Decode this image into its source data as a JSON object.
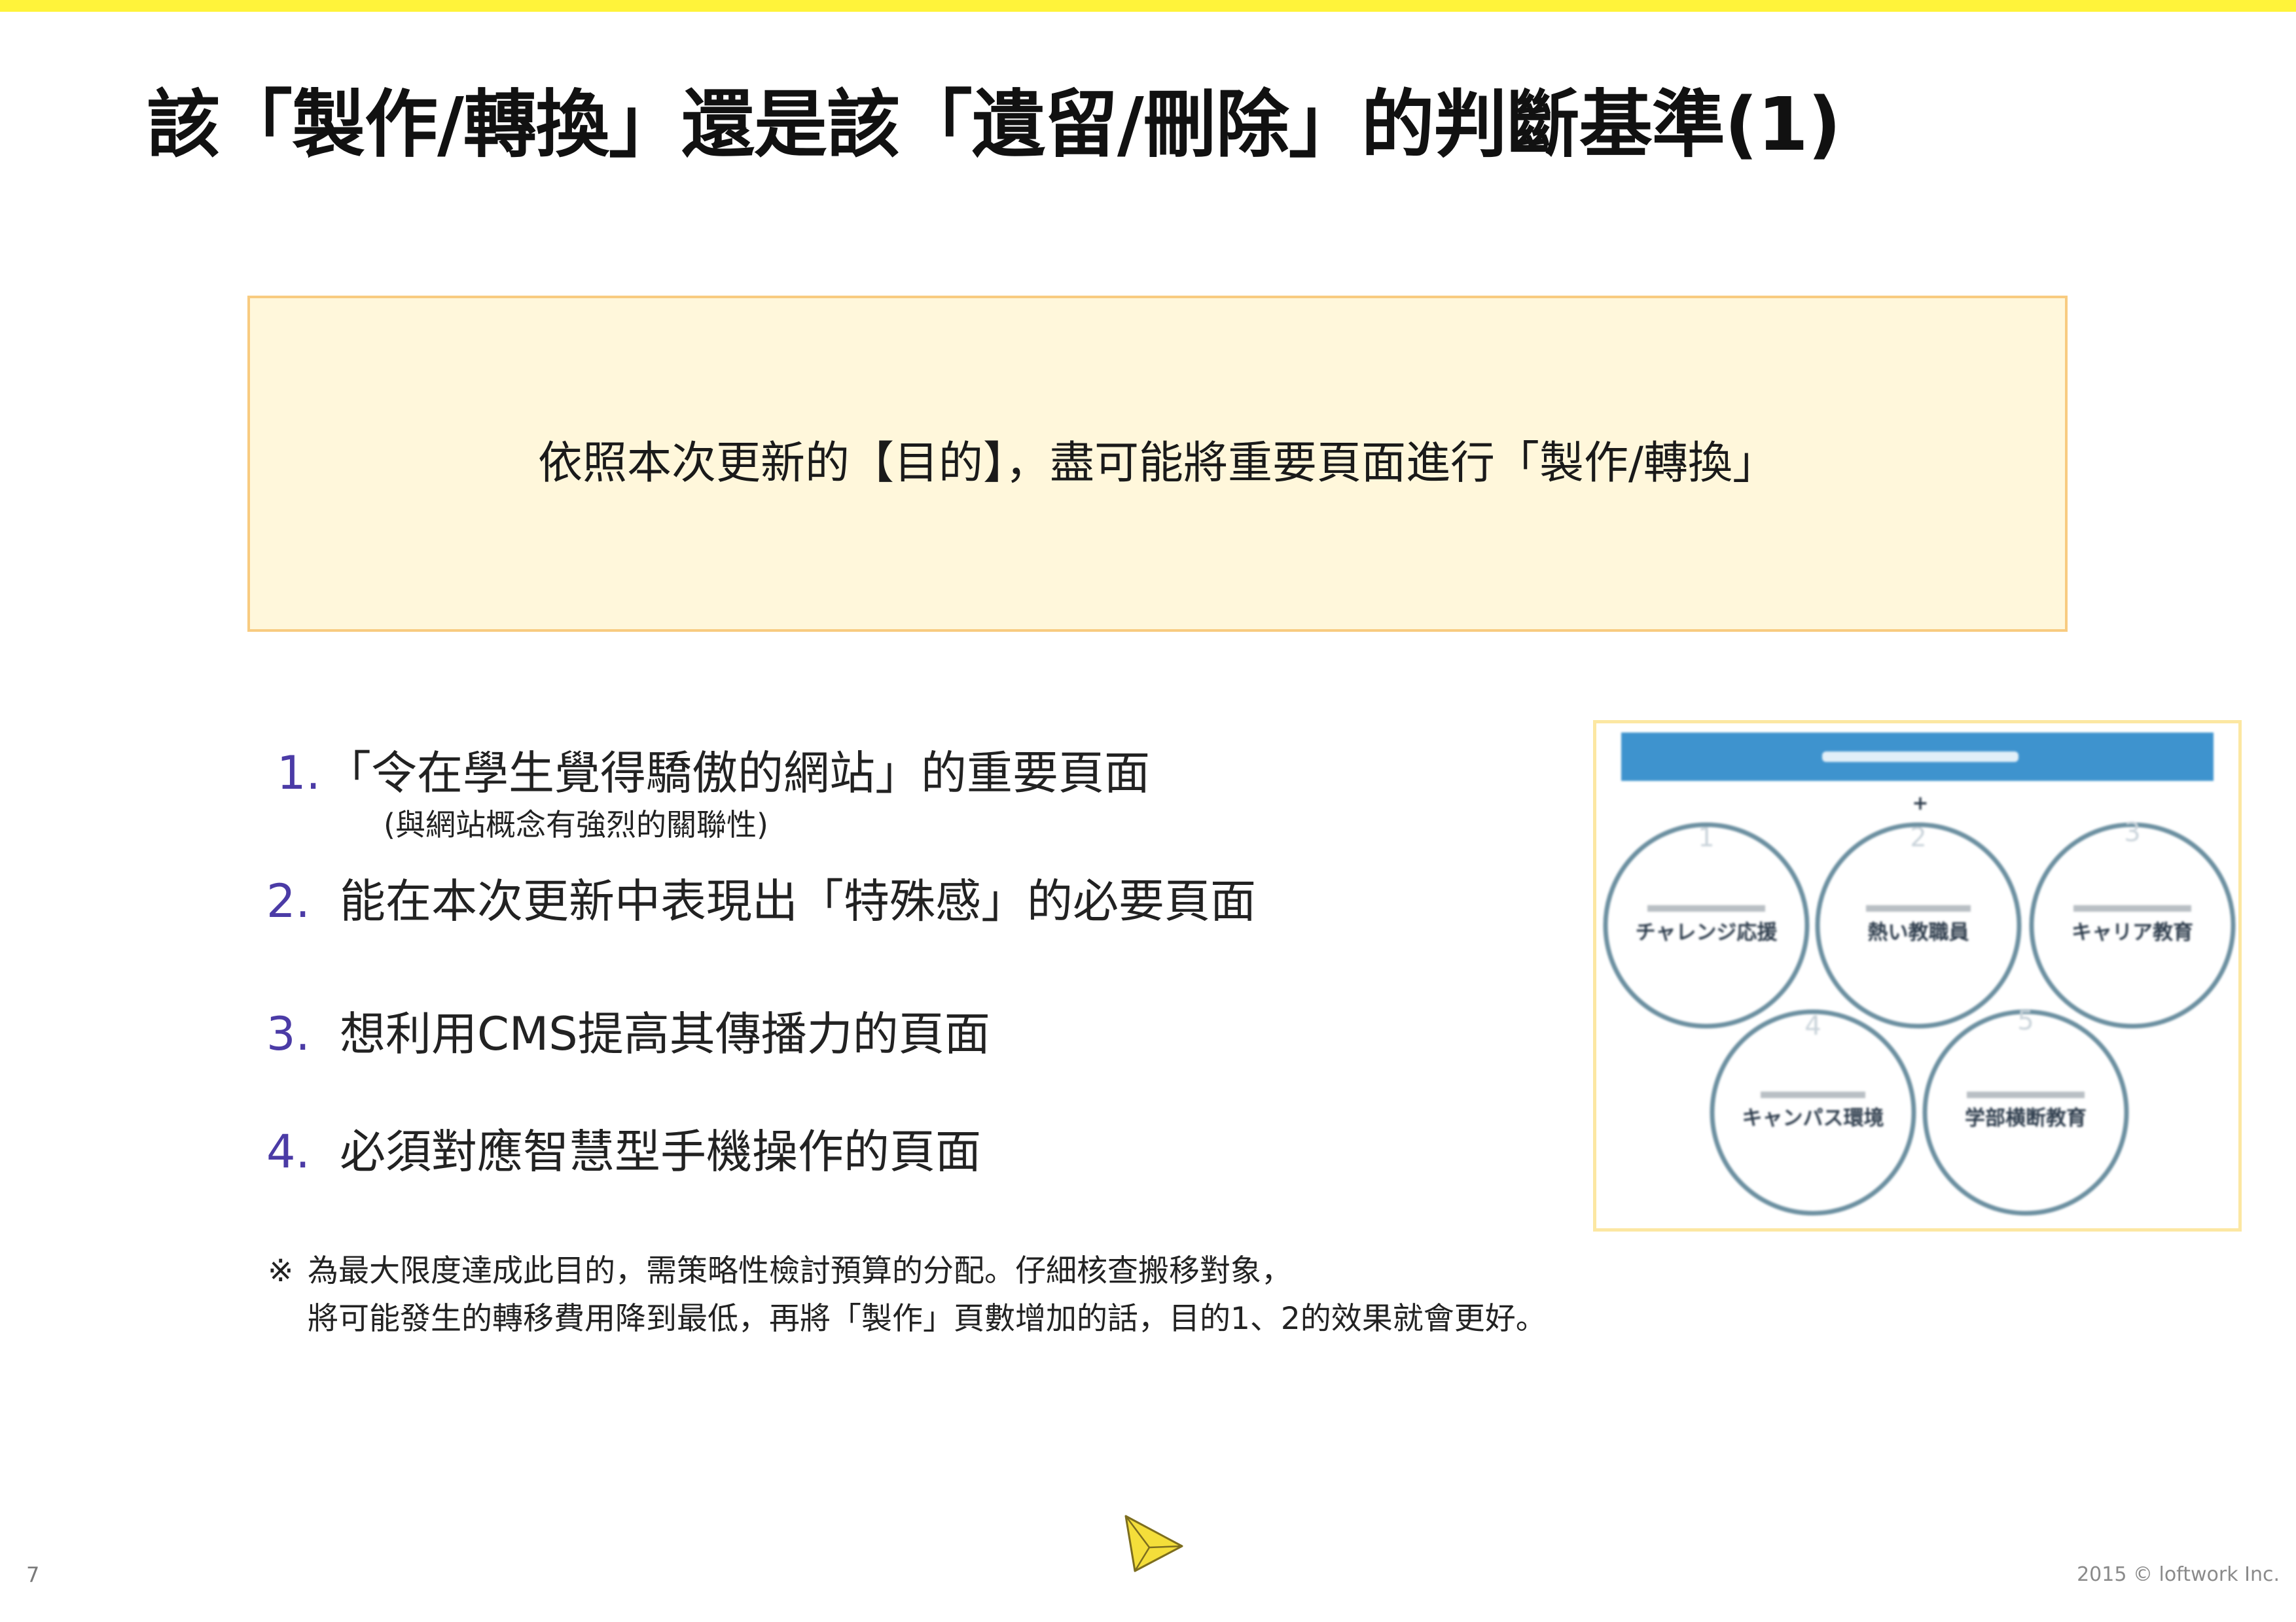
{
  "slide": {
    "title": "該「製作/轉換」還是該「遺留/刪除」的判斷基準(1)",
    "key_message": "依照本次更新的【目的】，盡可能將重要頁面進行「製作/轉換」",
    "criteria": [
      {
        "number": "1.",
        "text": "「令在學生覺得驕傲的網站」的重要頁面",
        "note": "(與網站概念有強烈的關聯性)"
      },
      {
        "number": "2.",
        "text": "能在本次更新中表現出「特殊感」的必要頁面"
      },
      {
        "number": "3.",
        "text": "想利用CMS提高其傳播力的頁面"
      },
      {
        "number": "4.",
        "text": "必須對應智慧型手機操作的頁面"
      }
    ],
    "footnote": {
      "mark": "※",
      "lines": [
        "為最大限度達成此目的，需策略性檢討預算的分配。仔細核查搬移對象，",
        "將可能發生的轉移費用降到最低，再將「製作」頁數增加的話，目的1、2的效果就會更好。"
      ]
    },
    "diagram": {
      "plus_sign": "+",
      "circles": [
        {
          "number": "1",
          "label": "チャレンジ応援"
        },
        {
          "number": "2",
          "label": "熱い教職員"
        },
        {
          "number": "3",
          "label": "キャリア教育"
        },
        {
          "number": "4",
          "label": "キャンパス環境"
        },
        {
          "number": "5",
          "label": "学部横断教育"
        }
      ]
    },
    "logo_icon": "loftwork-triangle-logo",
    "page_number": "7",
    "copyright": "2015 © loftwork Inc."
  },
  "colors": {
    "top_bar": "#FFF33A",
    "box_fill": "#FFF7DB",
    "box_border": "#F8CB80",
    "list_number": "#4B3BA6",
    "text": "#1A1A1A",
    "diagram_header": "#3E93CE",
    "diagram_circle": "#6B8FA0",
    "diagram_frame": "#FCE7A2"
  }
}
